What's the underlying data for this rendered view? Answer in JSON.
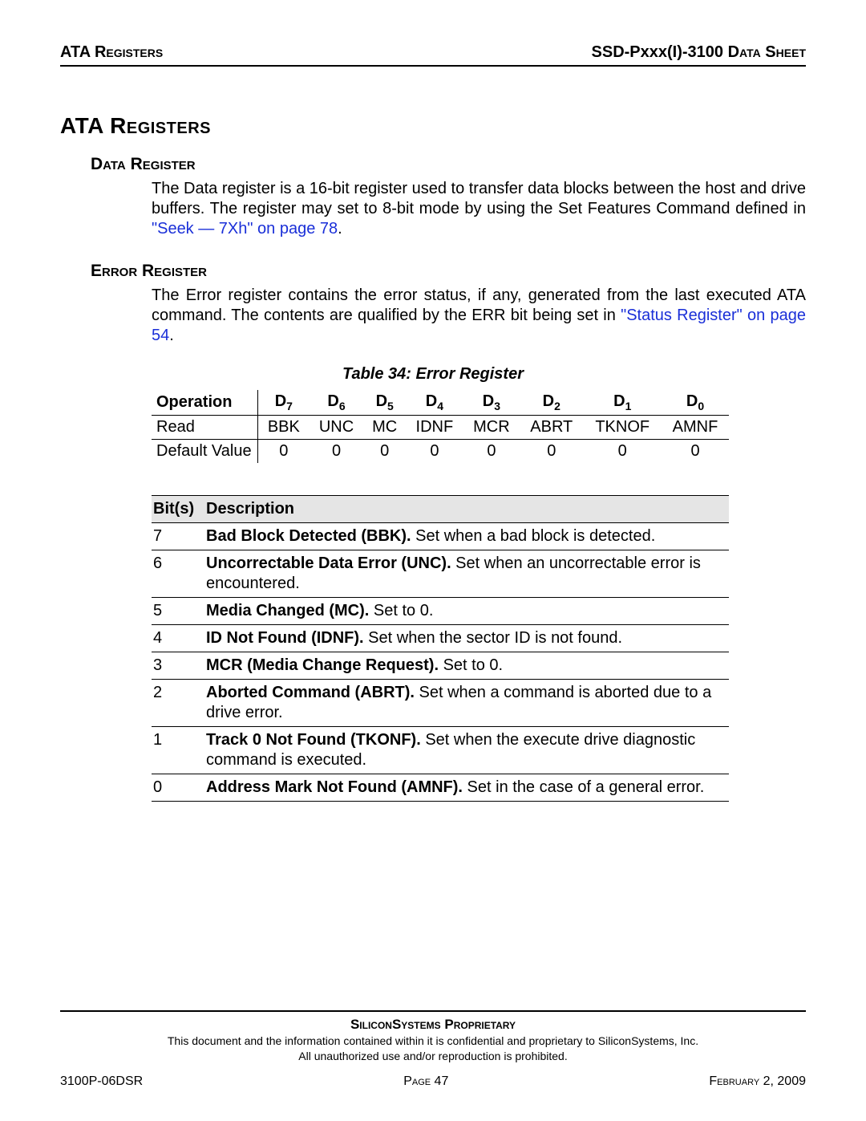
{
  "header": {
    "left": "ATA Registers",
    "right_a": "SSD-Pxxx(I)-3100 D",
    "right_b": "ata",
    "right_c": " S",
    "right_d": "heet"
  },
  "title": "ATA Registers",
  "sections": {
    "data_register": {
      "heading": "Data Register",
      "text_pre": "The Data register is a 16-bit register used to transfer data blocks between the host and drive buffers. The register may set to 8-bit mode by using the Set Features Command defined in ",
      "link": "\"Seek — 7Xh\" on page 78",
      "text_post": "."
    },
    "error_register": {
      "heading": "Error Register",
      "text_pre": "The Error register contains the error status, if any, generated from the last executed ATA command. The contents are qualified by the ERR bit being set in ",
      "link": "\"Status Register\" on page 54",
      "text_post": "."
    }
  },
  "table34": {
    "caption": "Table 34:  Error Register",
    "headers": [
      "Operation",
      "D7",
      "D6",
      "D5",
      "D4",
      "D3",
      "D2",
      "D1",
      "D0"
    ],
    "rows": [
      {
        "op": "Read",
        "cells": [
          "BBK",
          "UNC",
          "MC",
          "IDNF",
          "MCR",
          "ABRT",
          "TKNOF",
          "AMNF"
        ]
      },
      {
        "op": "Default Value",
        "cells": [
          "0",
          "0",
          "0",
          "0",
          "0",
          "0",
          "0",
          "0"
        ]
      }
    ]
  },
  "bits_table": {
    "headers": [
      "Bit(s)",
      "Description"
    ],
    "rows": [
      {
        "bit": "7",
        "bold": "Bad Block Detected (BBK).",
        "rest": " Set when a bad block is detected."
      },
      {
        "bit": "6",
        "bold": "Uncorrectable Data Error (UNC).",
        "rest": " Set when an uncorrectable error is encountered."
      },
      {
        "bit": "5",
        "bold": "Media Changed (MC).",
        "rest": " Set to 0."
      },
      {
        "bit": "4",
        "bold": "ID Not Found (IDNF).",
        "rest": " Set when the sector ID is not found."
      },
      {
        "bit": "3",
        "bold": "MCR (Media Change Request).",
        "rest": " Set to 0."
      },
      {
        "bit": "2",
        "bold": "Aborted Command (ABRT).",
        "rest": " Set when a command is aborted due to a drive error."
      },
      {
        "bit": "1",
        "bold": "Track 0 Not Found (TKONF).",
        "rest": " Set when the execute drive diagnostic command is executed."
      },
      {
        "bit": "0",
        "bold": "Address Mark Not Found (AMNF).",
        "rest": " Set in the case of a general error."
      }
    ]
  },
  "footer": {
    "prop": "SiliconSystems Proprietary",
    "conf1": "This document and the information contained within it is confidential and proprietary to SiliconSystems, Inc.",
    "conf2": "All unauthorized use and/or reproduction is prohibited.",
    "left": "3100P-06DSR",
    "center_a": "P",
    "center_b": "age",
    "center_c": " 47",
    "right_a": "F",
    "right_b": "ebruary",
    "right_c": " 2, 2009"
  },
  "chart_data": {
    "type": "table",
    "title": "Table 34: Error Register",
    "columns": [
      "Operation",
      "D7",
      "D6",
      "D5",
      "D4",
      "D3",
      "D2",
      "D1",
      "D0"
    ],
    "rows": [
      [
        "Read",
        "BBK",
        "UNC",
        "MC",
        "IDNF",
        "MCR",
        "ABRT",
        "TKNOF",
        "AMNF"
      ],
      [
        "Default Value",
        "0",
        "0",
        "0",
        "0",
        "0",
        "0",
        "0",
        "0"
      ]
    ],
    "bit_descriptions": [
      {
        "bit": 7,
        "name": "Bad Block Detected (BBK)",
        "desc": "Set when a bad block is detected."
      },
      {
        "bit": 6,
        "name": "Uncorrectable Data Error (UNC)",
        "desc": "Set when an uncorrectable error is encountered."
      },
      {
        "bit": 5,
        "name": "Media Changed (MC)",
        "desc": "Set to 0."
      },
      {
        "bit": 4,
        "name": "ID Not Found (IDNF)",
        "desc": "Set when the sector ID is not found."
      },
      {
        "bit": 3,
        "name": "MCR (Media Change Request)",
        "desc": "Set to 0."
      },
      {
        "bit": 2,
        "name": "Aborted Command (ABRT)",
        "desc": "Set when a command is aborted due to a drive error."
      },
      {
        "bit": 1,
        "name": "Track 0 Not Found (TKONF)",
        "desc": "Set when the execute drive diagnostic command is executed."
      },
      {
        "bit": 0,
        "name": "Address Mark Not Found (AMNF)",
        "desc": "Set in the case of a general error."
      }
    ]
  }
}
